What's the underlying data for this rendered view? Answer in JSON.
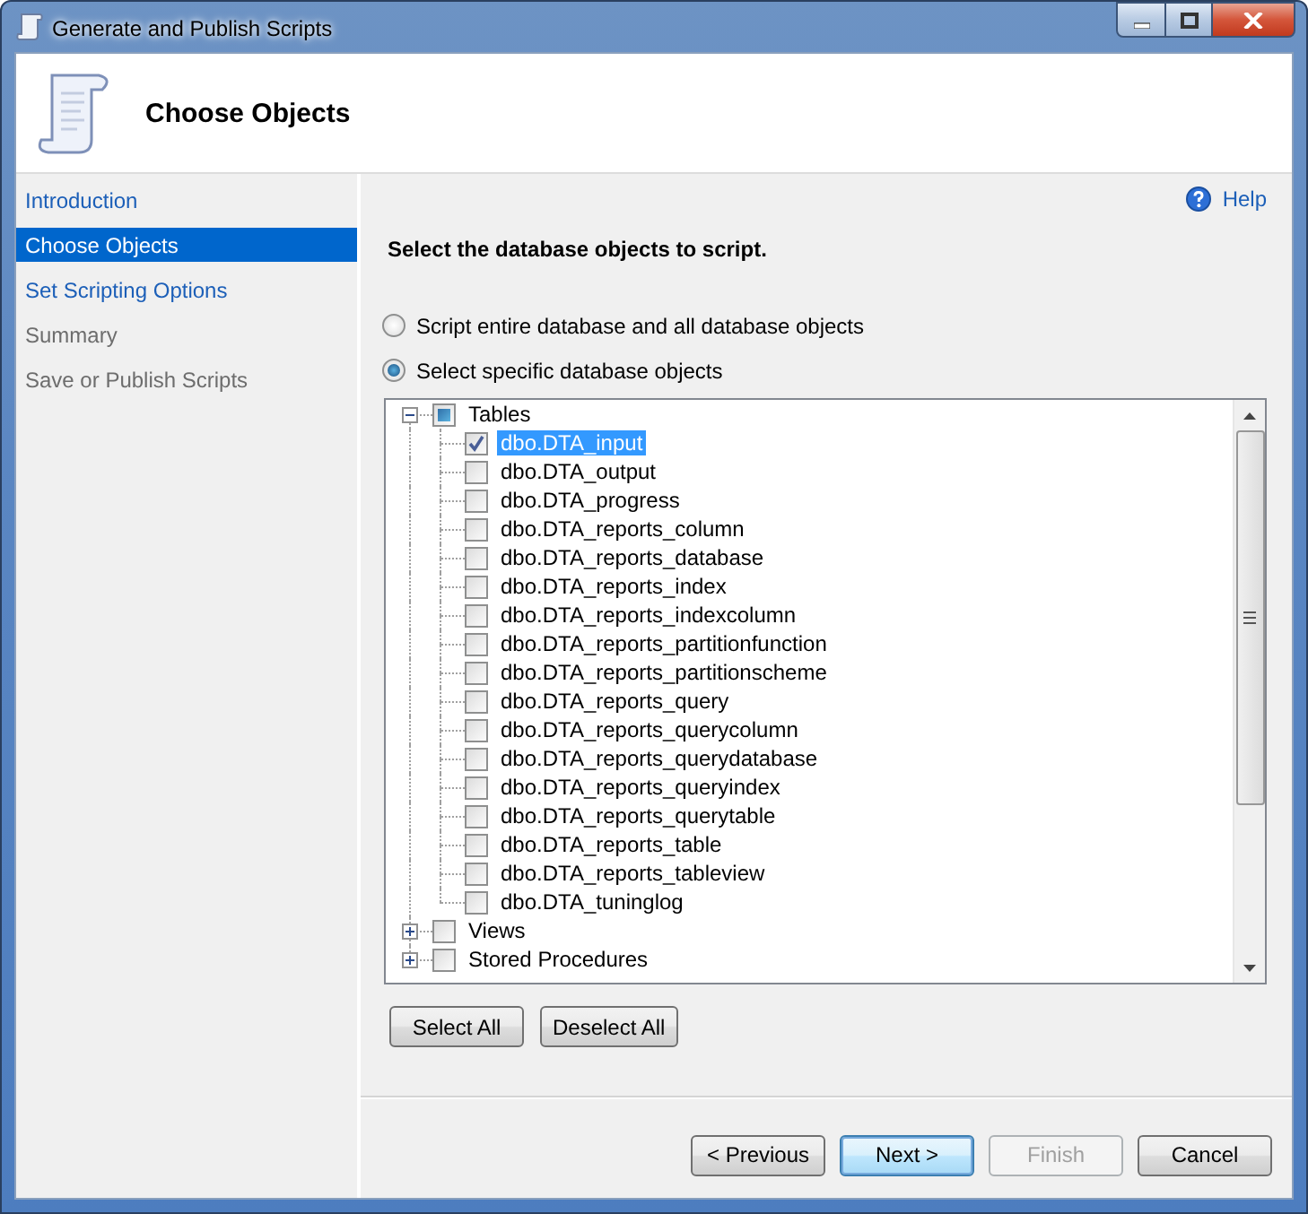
{
  "window": {
    "title": "Generate and Publish Scripts"
  },
  "header": {
    "title": "Choose Objects"
  },
  "sidebar": {
    "items": [
      {
        "label": "Introduction",
        "enabled": true,
        "selected": false
      },
      {
        "label": "Choose Objects",
        "enabled": true,
        "selected": true
      },
      {
        "label": "Set Scripting Options",
        "enabled": true,
        "selected": false
      },
      {
        "label": "Summary",
        "enabled": false,
        "selected": false
      },
      {
        "label": "Save or Publish Scripts",
        "enabled": false,
        "selected": false
      }
    ]
  },
  "help": {
    "label": "Help"
  },
  "heading": "Select the database objects to script.",
  "options": [
    {
      "label": "Script entire database and all database objects",
      "selected": false
    },
    {
      "label": "Select specific database objects",
      "selected": true
    }
  ],
  "tree": {
    "nodes": [
      {
        "label": "Tables",
        "expanded": true,
        "checked": false,
        "partial": true,
        "selected": false,
        "children": [
          {
            "label": "dbo.DTA_input",
            "checked": true,
            "selected": true
          },
          {
            "label": "dbo.DTA_output",
            "checked": false,
            "selected": false
          },
          {
            "label": "dbo.DTA_progress",
            "checked": false,
            "selected": false
          },
          {
            "label": "dbo.DTA_reports_column",
            "checked": false,
            "selected": false
          },
          {
            "label": "dbo.DTA_reports_database",
            "checked": false,
            "selected": false
          },
          {
            "label": "dbo.DTA_reports_index",
            "checked": false,
            "selected": false
          },
          {
            "label": "dbo.DTA_reports_indexcolumn",
            "checked": false,
            "selected": false
          },
          {
            "label": "dbo.DTA_reports_partitionfunction",
            "checked": false,
            "selected": false
          },
          {
            "label": "dbo.DTA_reports_partitionscheme",
            "checked": false,
            "selected": false
          },
          {
            "label": "dbo.DTA_reports_query",
            "checked": false,
            "selected": false
          },
          {
            "label": "dbo.DTA_reports_querycolumn",
            "checked": false,
            "selected": false
          },
          {
            "label": "dbo.DTA_reports_querydatabase",
            "checked": false,
            "selected": false
          },
          {
            "label": "dbo.DTA_reports_queryindex",
            "checked": false,
            "selected": false
          },
          {
            "label": "dbo.DTA_reports_querytable",
            "checked": false,
            "selected": false
          },
          {
            "label": "dbo.DTA_reports_table",
            "checked": false,
            "selected": false
          },
          {
            "label": "dbo.DTA_reports_tableview",
            "checked": false,
            "selected": false
          },
          {
            "label": "dbo.DTA_tuninglog",
            "checked": false,
            "selected": false
          }
        ]
      },
      {
        "label": "Views",
        "expanded": false,
        "checked": false,
        "partial": false,
        "selected": false
      },
      {
        "label": "Stored Procedures",
        "expanded": false,
        "checked": false,
        "partial": false,
        "selected": false
      }
    ]
  },
  "selection_buttons": [
    {
      "label": "Select All",
      "disabled": false
    },
    {
      "label": "Deselect All",
      "disabled": false
    }
  ],
  "nav_buttons": [
    {
      "label": "< Previous",
      "disabled": false,
      "default": false
    },
    {
      "label": "Next >",
      "disabled": false,
      "default": true
    },
    {
      "label": "Finish",
      "disabled": true,
      "default": false
    },
    {
      "label": "Cancel",
      "disabled": false,
      "default": false
    }
  ]
}
